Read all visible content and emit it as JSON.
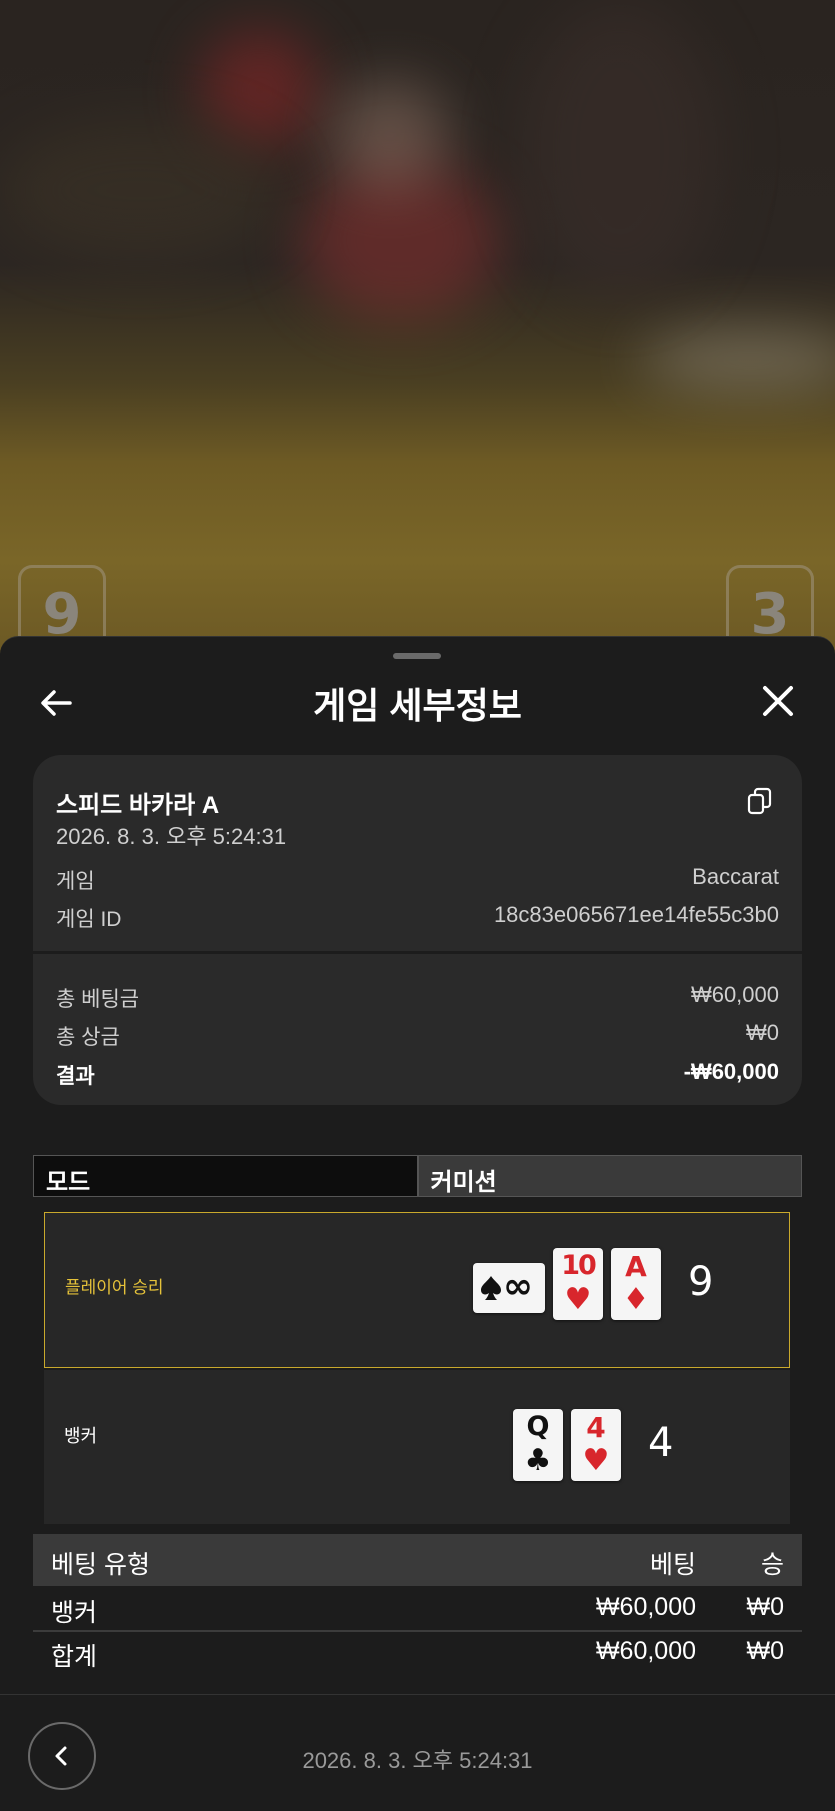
{
  "scene": {
    "left_score": "9",
    "right_score": "3"
  },
  "header": {
    "title": "게임 세부정보",
    "back_icon": "arrow-left-icon",
    "close_icon": "close-icon"
  },
  "summary": {
    "game_name": "스피드 바카라 A",
    "datetime": "2026. 8. 3. 오후 5:24:31",
    "game_label": "게임",
    "game_value": "Baccarat",
    "game_id_label": "게임 ID",
    "game_id_value": "18c83e065671ee14fe55c3b0",
    "total_bet_label": "총 베팅금",
    "total_bet_value": "₩60,000",
    "total_win_label": "총 상금",
    "total_win_value": "₩0",
    "result_label": "결과",
    "result_value": "-₩60,000"
  },
  "tabs": {
    "mode": "모드",
    "commission": "커미션"
  },
  "player": {
    "label": "플레이어 승리",
    "cards": [
      {
        "rank": "∞",
        "suit": "♠",
        "color": "#111111"
      },
      {
        "rank": "10",
        "suit": "♥",
        "color": "#d8262c"
      },
      {
        "rank": "A",
        "suit": "♦",
        "color": "#d8262c"
      }
    ],
    "total": "9"
  },
  "banker": {
    "label": "뱅커",
    "cards": [
      {
        "rank": "Q",
        "suit": "♣",
        "color": "#111111"
      },
      {
        "rank": "4",
        "suit": "♥",
        "color": "#d8262c"
      }
    ],
    "total": "4"
  },
  "bets": {
    "headers": {
      "type": "베팅 유형",
      "bet": "베팅",
      "win": "승"
    },
    "rows": [
      {
        "type": "뱅커",
        "bet": "₩60,000",
        "win": "₩0"
      }
    ],
    "total": {
      "type": "합계",
      "bet": "₩60,000",
      "win": "₩0"
    }
  },
  "footer": {
    "datetime": "2026. 8. 3. 오후 5:24:31"
  },
  "colors": {
    "accent": "#c9a92c",
    "background": "#1c1c1c",
    "card": "#2a2a2a"
  }
}
